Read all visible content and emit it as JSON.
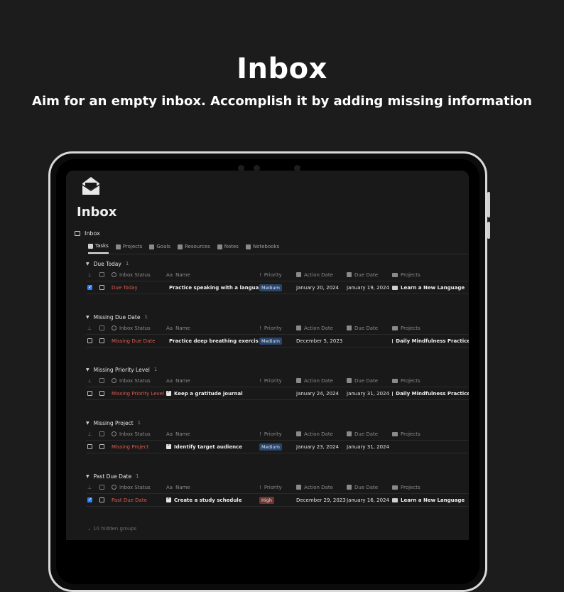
{
  "hero": {
    "title": "Inbox",
    "subtitle": "Aim for an empty inbox. Accomplish it by adding missing information"
  },
  "page": {
    "title": "Inbox",
    "icon": "inbox-envelope-icon",
    "database_title": "Inbox"
  },
  "tabs": [
    {
      "label": "Tasks",
      "icon": "checkbox-icon",
      "active": true
    },
    {
      "label": "Projects",
      "icon": "folder-icon",
      "active": false
    },
    {
      "label": "Goals",
      "icon": "target-icon",
      "active": false
    },
    {
      "label": "Resources",
      "icon": "bookmark-icon",
      "active": false
    },
    {
      "label": "Notes",
      "icon": "note-icon",
      "active": false
    },
    {
      "label": "Notebooks",
      "icon": "notebook-icon",
      "active": false
    }
  ],
  "columns": {
    "status": "Inbox Status",
    "name": "Name",
    "priority": "Priority",
    "action_date": "Action Date",
    "due_date": "Due Date",
    "projects": "Projects",
    "name_prefix": "Aa",
    "priority_prefix": "!"
  },
  "groups": [
    {
      "title": "Due Today",
      "count": "1",
      "row": {
        "pinned": true,
        "status": "Due Today",
        "name": "Practice speaking with a language",
        "priority": "Medium",
        "priority_kind": "med",
        "action_date": "January 20, 2024",
        "due_date": "January 19, 2024",
        "project": "Learn a New Language"
      }
    },
    {
      "title": "Missing Due Date",
      "count": "1",
      "row": {
        "pinned": false,
        "status": "Missing Due Date",
        "name": "Practice deep breathing exercises",
        "priority": "Medium",
        "priority_kind": "med",
        "action_date": "December 5, 2023",
        "due_date": "",
        "project": "Daily Mindfulness Practice"
      }
    },
    {
      "title": "Missing Priority Level",
      "count": "1",
      "row": {
        "pinned": false,
        "status": "Missing Priority Level",
        "name": "Keep a gratitude journal",
        "priority": "",
        "priority_kind": "",
        "action_date": "January 24, 2024",
        "due_date": "January 31, 2024",
        "project": "Daily Mindfulness Practice"
      }
    },
    {
      "title": "Missing Project",
      "count": "1",
      "row": {
        "pinned": false,
        "status": "Missing Project",
        "name": "Identify target audience",
        "priority": "Medium",
        "priority_kind": "med",
        "action_date": "January 23, 2024",
        "due_date": "January 31, 2024",
        "project": ""
      }
    },
    {
      "title": "Past Due Date",
      "count": "1",
      "row": {
        "pinned": true,
        "status": "Past Due Date",
        "name": "Create a study schedule",
        "priority": "High",
        "priority_kind": "high",
        "action_date": "December 29, 2023",
        "due_date": "January 16, 2024",
        "project": "Learn a New Language"
      }
    }
  ],
  "footer": {
    "hidden_groups": "10 hidden groups"
  }
}
